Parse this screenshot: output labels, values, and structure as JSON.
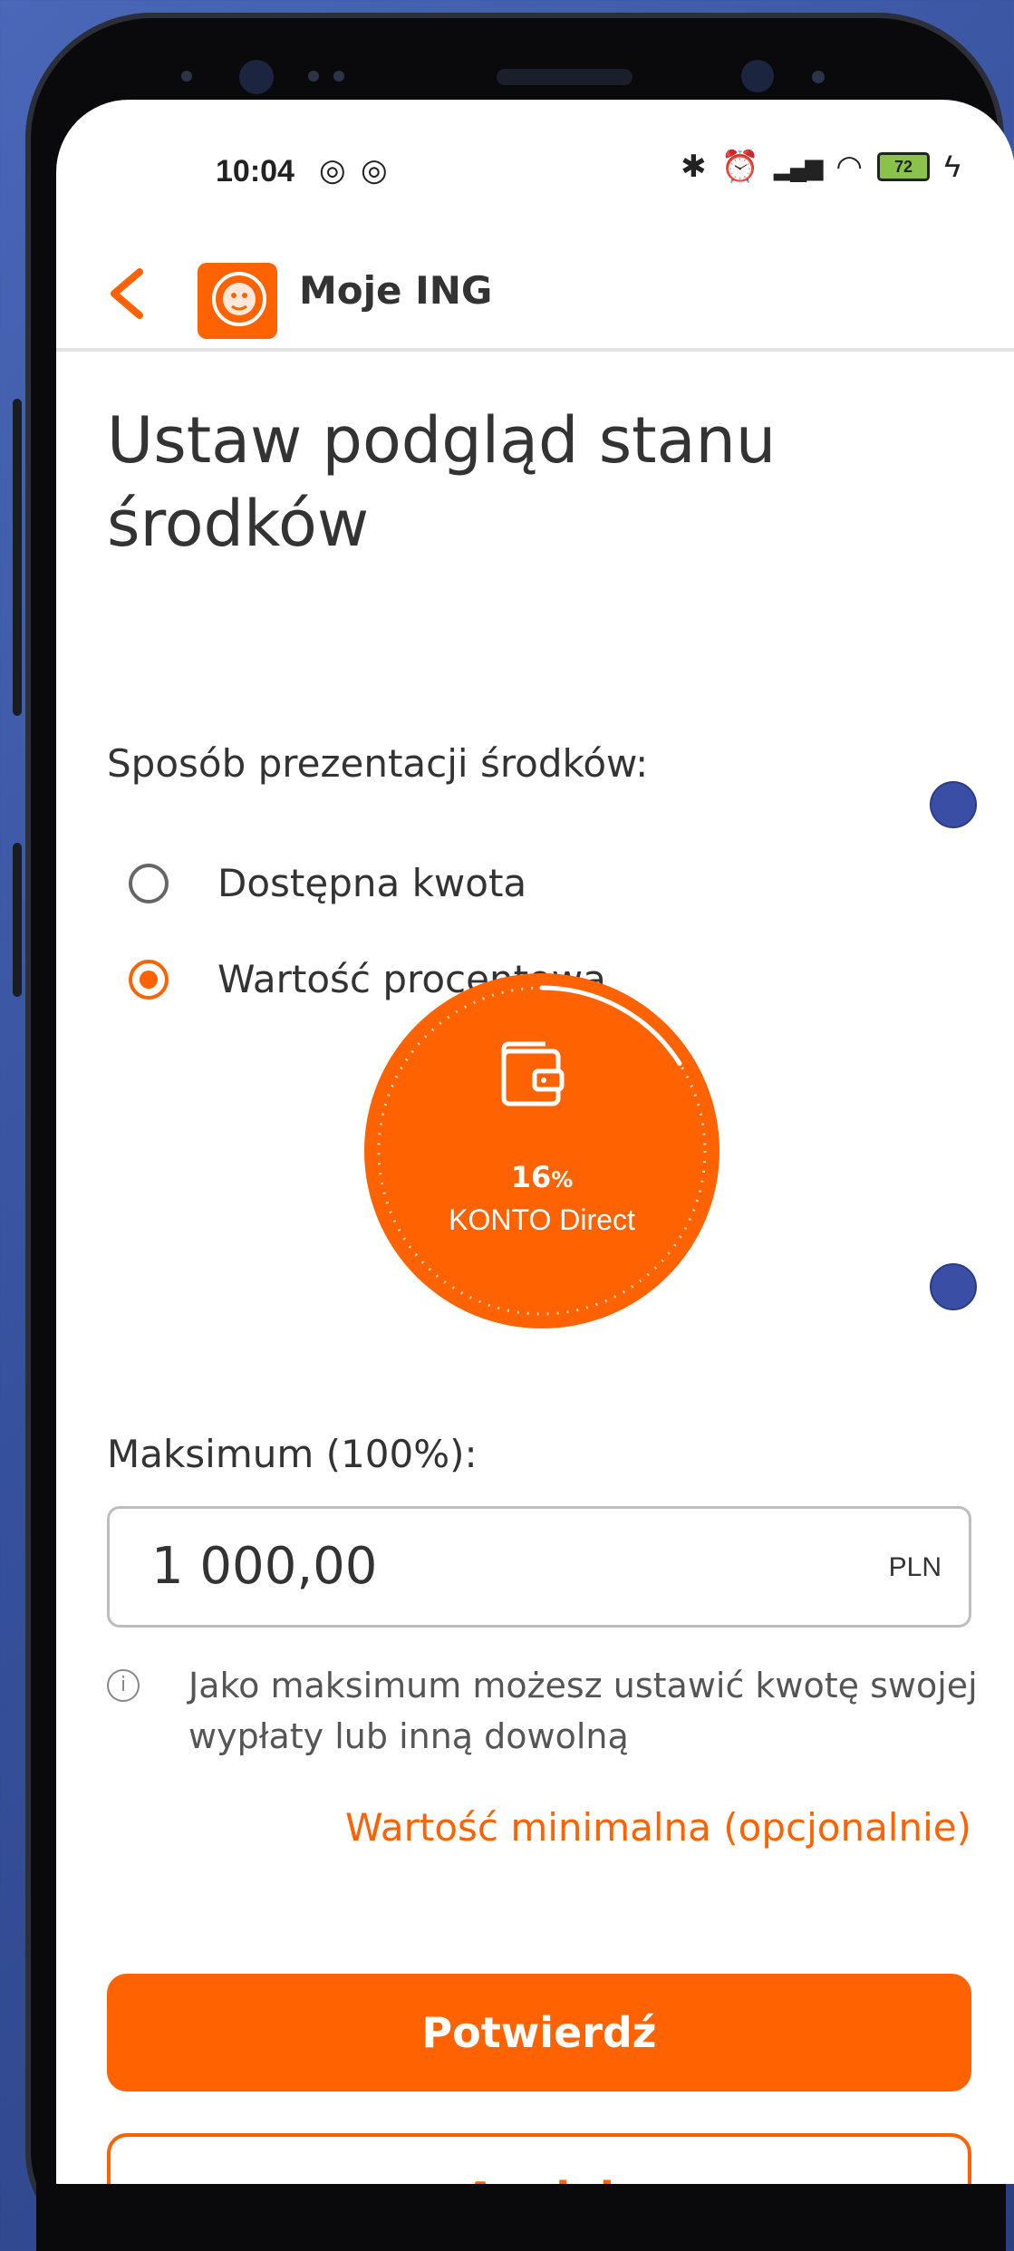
{
  "status_bar": {
    "time": "10:04",
    "battery": "72",
    "icons": [
      "sync-icon",
      "sync-icon",
      "bluetooth-icon",
      "alarm-icon",
      "signal-icon",
      "wifi-icon",
      "battery-icon",
      "charging-icon"
    ]
  },
  "app_bar": {
    "title": "Moje ING",
    "back_icon": "chevron-left-icon",
    "logo_icon": "ing-lion-logo"
  },
  "page": {
    "title_line1": "Ustaw podgląd stanu",
    "title_line2": "środków",
    "presentation_label": "Sposób prezentacji środków:",
    "options": [
      {
        "label": "Dostępna kwota",
        "selected": false
      },
      {
        "label": "Wartość procentowa",
        "selected": true
      }
    ]
  },
  "preview": {
    "percent": 16,
    "percent_value": "16",
    "percent_unit": "%",
    "account_name": "KONTO Direct",
    "icon": "wallet-icon"
  },
  "maximum": {
    "label": "Maksimum (100%):",
    "value": "1 000,00",
    "currency": "PLN",
    "info_text": "Jako maksimum możesz ustawić kwotę swojej wypłaty lub inną dowolną",
    "info_icon": "info-icon"
  },
  "links": {
    "min_value": "Wartość minimalna (opcjonalnie)"
  },
  "buttons": {
    "confirm": "Potwierdź",
    "cancel": "Anuluj"
  },
  "colors": {
    "accent": "#ff6200",
    "background": "#4a67b8"
  }
}
